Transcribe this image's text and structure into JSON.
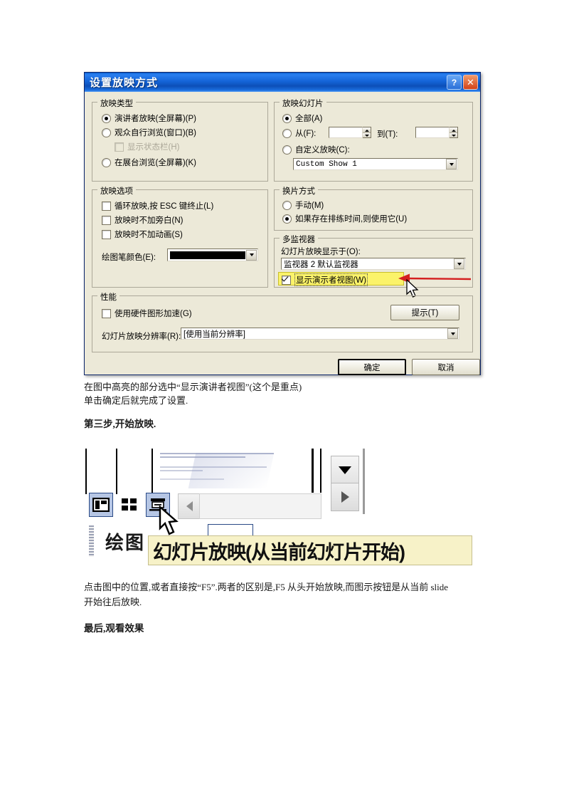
{
  "document": {
    "paragraph1_line1": "在图中高亮的部分选中“显示演讲者视图”(这个是重点)",
    "paragraph1_line2": "单击确定后就完成了设置.",
    "heading_step3": "第三步,开始放映.",
    "paragraph2_line1": "点击图中的位置,或者直接按“F5”.两者的区别是,F5 从头开始放映,而图示按钮是从当前 slide",
    "paragraph2_line2": "开始往后放映.",
    "heading_final": "最后,观看效果"
  },
  "dialog": {
    "title": "设置放映方式",
    "help_button": "?",
    "close_button": "✕",
    "show_type": {
      "legend": "放映类型",
      "options": [
        {
          "label": "演讲者放映(全屏幕)(P)",
          "selected": true
        },
        {
          "label": "观众自行浏览(窗口)(B)",
          "selected": false
        },
        {
          "label": "在展台浏览(全屏幕)(K)",
          "selected": false
        }
      ],
      "status_bar_checkbox": {
        "label": "显示状态栏(H)",
        "checked": false,
        "disabled": true
      }
    },
    "show_slides": {
      "legend": "放映幻灯片",
      "all": {
        "label": "全部(A)",
        "selected": true
      },
      "from": {
        "label": "从(F):",
        "value": ""
      },
      "to": {
        "label": "到(T):",
        "value": ""
      },
      "custom": {
        "label": "自定义放映(C):",
        "selected": false
      },
      "custom_value": "Custom Show 1"
    },
    "show_options": {
      "legend": "放映选项",
      "checkboxes": [
        {
          "label": "循环放映,按 ESC 键终止(L)",
          "checked": false
        },
        {
          "label": "放映时不加旁白(N)",
          "checked": false
        },
        {
          "label": "放映时不加动画(S)",
          "checked": false
        }
      ],
      "pen_color_label": "绘图笔颜色(E):",
      "pen_color_value": "#000000"
    },
    "advance_slides": {
      "legend": "换片方式",
      "options": [
        {
          "label": "手动(M)",
          "selected": false
        },
        {
          "label": "如果存在排练时间,则使用它(U)",
          "selected": true
        }
      ]
    },
    "multiple_monitors": {
      "legend": "多监视器",
      "display_label": "幻灯片放映显示于(O):",
      "display_value": "监视器 2   默认监视器",
      "presenter_view": {
        "label": "显示演示者视图(W)",
        "checked": true,
        "highlighted": true
      }
    },
    "performance": {
      "legend": "性能",
      "hardware_accel": {
        "label": "使用硬件图形加速(G)",
        "checked": false
      },
      "tips_button": "提示(T)",
      "resolution_label": "幻灯片放映分辨率(R):",
      "resolution_value": "[使用当前分辨率]"
    },
    "buttons": {
      "ok": "确定",
      "cancel": "取消"
    }
  },
  "toolbar_screenshot": {
    "draw_menu_label": "绘图",
    "tooltip": "幻灯片放映(从当前幻灯片开始)",
    "view_buttons": [
      {
        "name": "normal-view",
        "selected": false
      },
      {
        "name": "slide-sorter-view",
        "selected": false
      },
      {
        "name": "slide-show-view",
        "selected": true
      }
    ]
  },
  "colors": {
    "titlebar_blue": "#1464d8",
    "dialog_face": "#ece9d8",
    "highlight_yellow": "#fbf36a",
    "arrow_red": "#d42020",
    "selected_button_blue": "#b6c6e4"
  }
}
